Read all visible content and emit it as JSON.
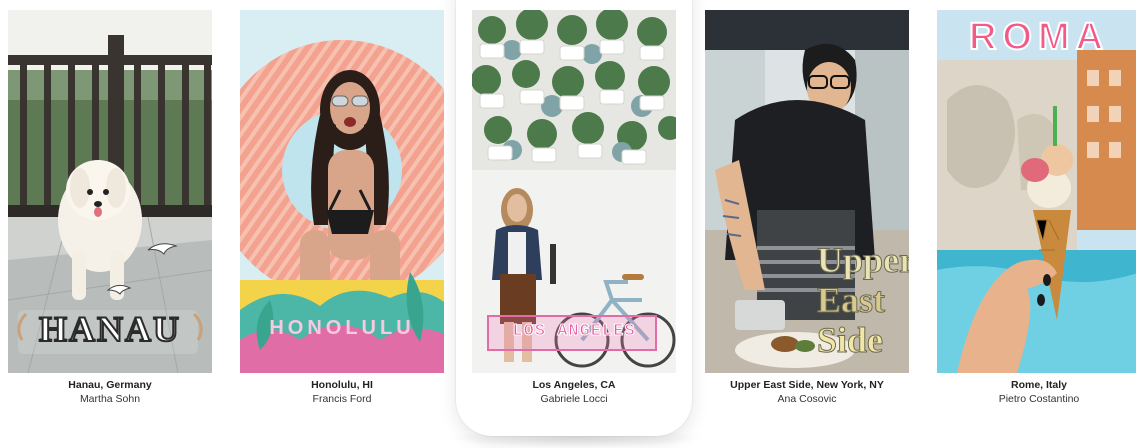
{
  "cards": [
    {
      "place": "Hanau, Germany",
      "author": "Martha Sohn",
      "filter_text": "HANAU"
    },
    {
      "place": "Honolulu, HI",
      "author": "Francis Ford",
      "filter_text": "HONOLULU"
    },
    {
      "place": "Los Angeles, CA",
      "author": "Gabriele Locci",
      "filter_text": "LOS ANGELES"
    },
    {
      "place": "Upper East Side, New York, NY",
      "author": "Ana Cosovic",
      "filter_lines": [
        "Upper",
        "East",
        "Side"
      ]
    },
    {
      "place": "Rome, Italy",
      "author": "Pietro Costantino",
      "filter_text": "ROMA"
    }
  ]
}
